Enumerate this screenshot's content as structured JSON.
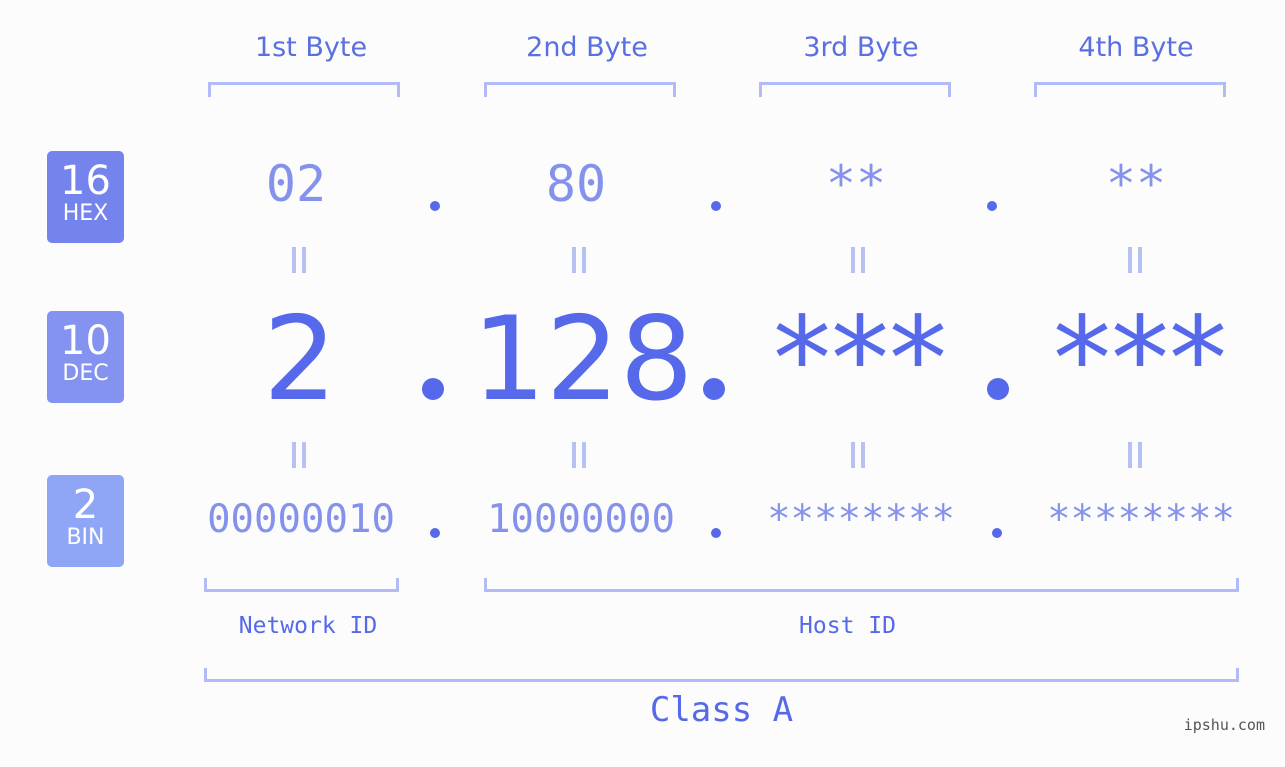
{
  "colors": {
    "accent": "#5569ea",
    "light_accent": "#8592ec",
    "bracket": "#b2bbf5",
    "hex_badge": "#7584ec",
    "dec_badge": "#8493ef",
    "bin_badge": "#8fa6f7",
    "background": "#fbfcfb"
  },
  "byte_headers": [
    "1st Byte",
    "2nd Byte",
    "3rd Byte",
    "4th Byte"
  ],
  "badges": {
    "hex": {
      "number": "16",
      "label": "HEX"
    },
    "dec": {
      "number": "10",
      "label": "DEC"
    },
    "bin": {
      "number": "2",
      "label": "BIN"
    }
  },
  "hex_values": [
    "02",
    "80",
    "**",
    "**"
  ],
  "dec_values": [
    "2",
    "128",
    "***",
    "***"
  ],
  "bin_values": [
    "00000010",
    "10000000",
    "********",
    "********"
  ],
  "separator": ".",
  "equals_symbol": "=",
  "network_id_label": "Network ID",
  "host_id_label": "Host ID",
  "class_label": "Class A",
  "watermark": "ipshu.com"
}
